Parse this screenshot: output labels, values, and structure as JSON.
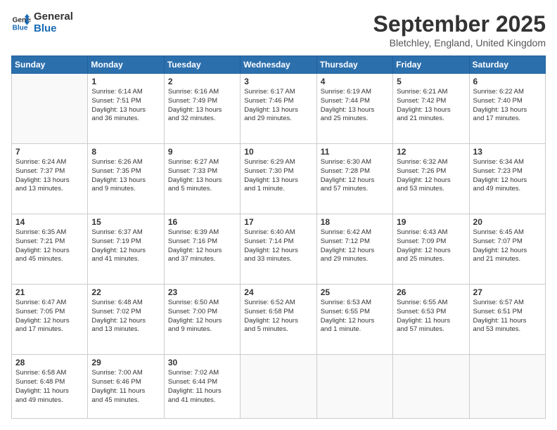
{
  "logo": {
    "line1": "General",
    "line2": "Blue"
  },
  "title": "September 2025",
  "location": "Bletchley, England, United Kingdom",
  "days_of_week": [
    "Sunday",
    "Monday",
    "Tuesday",
    "Wednesday",
    "Thursday",
    "Friday",
    "Saturday"
  ],
  "weeks": [
    [
      {
        "day": "",
        "content": ""
      },
      {
        "day": "1",
        "content": "Sunrise: 6:14 AM\nSunset: 7:51 PM\nDaylight: 13 hours\nand 36 minutes."
      },
      {
        "day": "2",
        "content": "Sunrise: 6:16 AM\nSunset: 7:49 PM\nDaylight: 13 hours\nand 32 minutes."
      },
      {
        "day": "3",
        "content": "Sunrise: 6:17 AM\nSunset: 7:46 PM\nDaylight: 13 hours\nand 29 minutes."
      },
      {
        "day": "4",
        "content": "Sunrise: 6:19 AM\nSunset: 7:44 PM\nDaylight: 13 hours\nand 25 minutes."
      },
      {
        "day": "5",
        "content": "Sunrise: 6:21 AM\nSunset: 7:42 PM\nDaylight: 13 hours\nand 21 minutes."
      },
      {
        "day": "6",
        "content": "Sunrise: 6:22 AM\nSunset: 7:40 PM\nDaylight: 13 hours\nand 17 minutes."
      }
    ],
    [
      {
        "day": "7",
        "content": "Sunrise: 6:24 AM\nSunset: 7:37 PM\nDaylight: 13 hours\nand 13 minutes."
      },
      {
        "day": "8",
        "content": "Sunrise: 6:26 AM\nSunset: 7:35 PM\nDaylight: 13 hours\nand 9 minutes."
      },
      {
        "day": "9",
        "content": "Sunrise: 6:27 AM\nSunset: 7:33 PM\nDaylight: 13 hours\nand 5 minutes."
      },
      {
        "day": "10",
        "content": "Sunrise: 6:29 AM\nSunset: 7:30 PM\nDaylight: 13 hours\nand 1 minute."
      },
      {
        "day": "11",
        "content": "Sunrise: 6:30 AM\nSunset: 7:28 PM\nDaylight: 12 hours\nand 57 minutes."
      },
      {
        "day": "12",
        "content": "Sunrise: 6:32 AM\nSunset: 7:26 PM\nDaylight: 12 hours\nand 53 minutes."
      },
      {
        "day": "13",
        "content": "Sunrise: 6:34 AM\nSunset: 7:23 PM\nDaylight: 12 hours\nand 49 minutes."
      }
    ],
    [
      {
        "day": "14",
        "content": "Sunrise: 6:35 AM\nSunset: 7:21 PM\nDaylight: 12 hours\nand 45 minutes."
      },
      {
        "day": "15",
        "content": "Sunrise: 6:37 AM\nSunset: 7:19 PM\nDaylight: 12 hours\nand 41 minutes."
      },
      {
        "day": "16",
        "content": "Sunrise: 6:39 AM\nSunset: 7:16 PM\nDaylight: 12 hours\nand 37 minutes."
      },
      {
        "day": "17",
        "content": "Sunrise: 6:40 AM\nSunset: 7:14 PM\nDaylight: 12 hours\nand 33 minutes."
      },
      {
        "day": "18",
        "content": "Sunrise: 6:42 AM\nSunset: 7:12 PM\nDaylight: 12 hours\nand 29 minutes."
      },
      {
        "day": "19",
        "content": "Sunrise: 6:43 AM\nSunset: 7:09 PM\nDaylight: 12 hours\nand 25 minutes."
      },
      {
        "day": "20",
        "content": "Sunrise: 6:45 AM\nSunset: 7:07 PM\nDaylight: 12 hours\nand 21 minutes."
      }
    ],
    [
      {
        "day": "21",
        "content": "Sunrise: 6:47 AM\nSunset: 7:05 PM\nDaylight: 12 hours\nand 17 minutes."
      },
      {
        "day": "22",
        "content": "Sunrise: 6:48 AM\nSunset: 7:02 PM\nDaylight: 12 hours\nand 13 minutes."
      },
      {
        "day": "23",
        "content": "Sunrise: 6:50 AM\nSunset: 7:00 PM\nDaylight: 12 hours\nand 9 minutes."
      },
      {
        "day": "24",
        "content": "Sunrise: 6:52 AM\nSunset: 6:58 PM\nDaylight: 12 hours\nand 5 minutes."
      },
      {
        "day": "25",
        "content": "Sunrise: 6:53 AM\nSunset: 6:55 PM\nDaylight: 12 hours\nand 1 minute."
      },
      {
        "day": "26",
        "content": "Sunrise: 6:55 AM\nSunset: 6:53 PM\nDaylight: 11 hours\nand 57 minutes."
      },
      {
        "day": "27",
        "content": "Sunrise: 6:57 AM\nSunset: 6:51 PM\nDaylight: 11 hours\nand 53 minutes."
      }
    ],
    [
      {
        "day": "28",
        "content": "Sunrise: 6:58 AM\nSunset: 6:48 PM\nDaylight: 11 hours\nand 49 minutes."
      },
      {
        "day": "29",
        "content": "Sunrise: 7:00 AM\nSunset: 6:46 PM\nDaylight: 11 hours\nand 45 minutes."
      },
      {
        "day": "30",
        "content": "Sunrise: 7:02 AM\nSunset: 6:44 PM\nDaylight: 11 hours\nand 41 minutes."
      },
      {
        "day": "",
        "content": ""
      },
      {
        "day": "",
        "content": ""
      },
      {
        "day": "",
        "content": ""
      },
      {
        "day": "",
        "content": ""
      }
    ]
  ]
}
